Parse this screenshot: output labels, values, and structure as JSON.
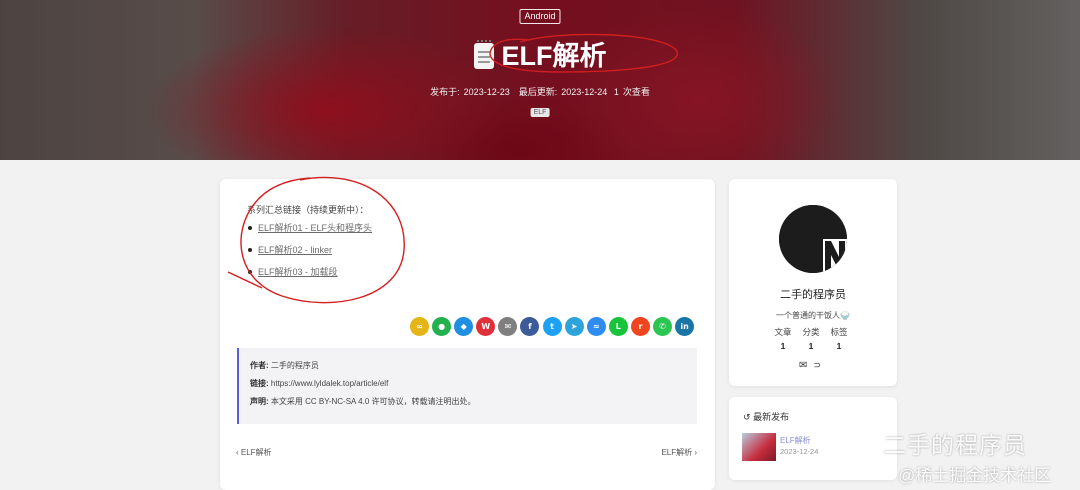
{
  "hero": {
    "category": "Android",
    "title": "ELF解析",
    "published_label": "发布于:",
    "published_date": "2023-12-23",
    "updated_label": "最后更新:",
    "updated_date": "2023-12-24",
    "views": "1",
    "views_label": "次查看",
    "tag": "ELF"
  },
  "article": {
    "series_intro": "系列汇总链接（持续更新中）：",
    "series_links": [
      "ELF解析01 - ELF头和程序头",
      "ELF解析02 - linker",
      "ELF解析03 - 加载段"
    ],
    "share_icons": [
      {
        "name": "link",
        "glyph": "∞",
        "color": "#e5b417"
      },
      {
        "name": "wechat",
        "glyph": "●",
        "color": "#22b14c"
      },
      {
        "name": "qq",
        "glyph": "◆",
        "color": "#1e8fe1"
      },
      {
        "name": "weibo",
        "glyph": "W",
        "color": "#e0303a"
      },
      {
        "name": "email",
        "glyph": "✉",
        "color": "#7f7f7f"
      },
      {
        "name": "facebook",
        "glyph": "f",
        "color": "#3b5b99"
      },
      {
        "name": "twitter",
        "glyph": "t",
        "color": "#1da1f2"
      },
      {
        "name": "telegram",
        "glyph": "➤",
        "color": "#2ea3db"
      },
      {
        "name": "messenger",
        "glyph": "≈",
        "color": "#2e8cf0"
      },
      {
        "name": "line",
        "glyph": "L",
        "color": "#19c33a"
      },
      {
        "name": "reddit",
        "glyph": "r",
        "color": "#f0461f"
      },
      {
        "name": "whatsapp",
        "glyph": "✆",
        "color": "#2cc552"
      },
      {
        "name": "linkedin",
        "glyph": "in",
        "color": "#1875a6"
      }
    ],
    "copyright": {
      "author_label": "作者:",
      "author": "二手的程序员",
      "link_label": "链接:",
      "link": "https://www.lyldalek.top/article/elf",
      "license_label": "声明:",
      "license": "本文采用 CC BY-NC-SA 4.0 许可协议，转载请注明出处。"
    },
    "prev": "ELF解析",
    "next": "ELF解析"
  },
  "sidebar": {
    "author_name": "二手的程序员",
    "bio": "一个普通的干饭人🍚",
    "stats": [
      {
        "label": "文章",
        "value": "1"
      },
      {
        "label": "分类",
        "value": "1"
      },
      {
        "label": "标签",
        "value": "1"
      }
    ],
    "recent_heading": "最新发布",
    "recent_title": "ELF解析",
    "recent_date": "2023-12-24"
  },
  "watermark": {
    "line1": "二手的程序员",
    "line2": "@稀土掘金技术社区"
  }
}
